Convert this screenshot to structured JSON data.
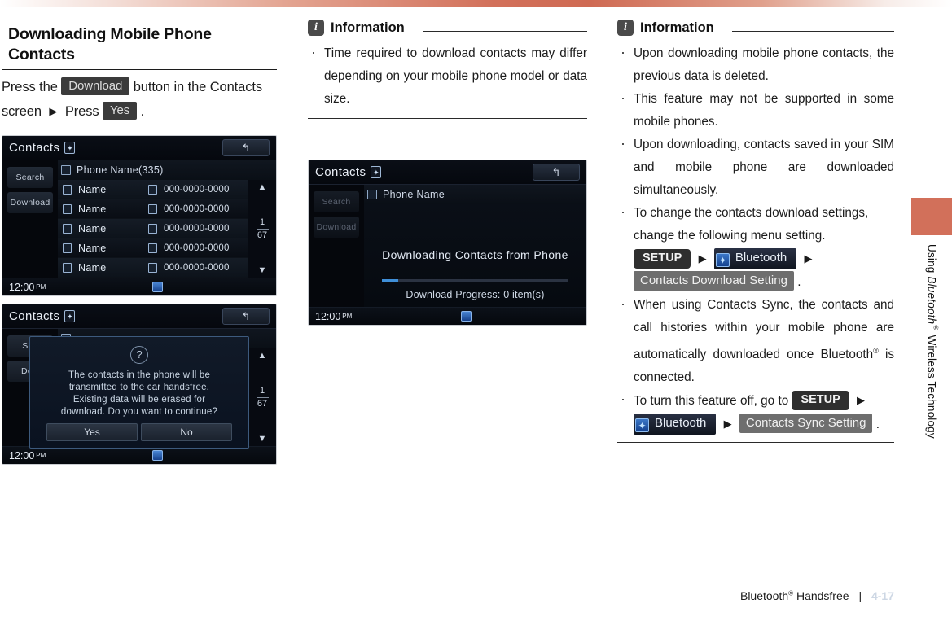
{
  "page": {
    "accent_color": "#d2705a",
    "side_tab_label_prefix": "Using ",
    "side_tab_label_italic": "Bluetooth",
    "side_tab_label_suffix": " Wireless Technology",
    "footer_text": "Bluetooth",
    "footer_text_suffix": " Handsfree",
    "footer_separator": "|",
    "footer_page": "4-17"
  },
  "left": {
    "title": "Downloading Mobile Phone Contacts",
    "instruction_part1": "Press the",
    "instruction_key_download": "Download",
    "instruction_part2": "button in the Contacts screen",
    "instruction_part3": "Press",
    "instruction_key_yes": "Yes",
    "instruction_period": "."
  },
  "screenshot_contacts": {
    "header_title": "Contacts",
    "back_icon": "↰",
    "rail": [
      {
        "label": "Search",
        "dim": false
      },
      {
        "label": "Download",
        "dim": false
      }
    ],
    "list_header": "Phone Name(335)",
    "rows": [
      {
        "name": "Name",
        "phone": "000-0000-0000"
      },
      {
        "name": "Name",
        "phone": "000-0000-0000"
      },
      {
        "name": "Name",
        "phone": "000-0000-0000"
      },
      {
        "name": "Name",
        "phone": "000-0000-0000"
      },
      {
        "name": "Name",
        "phone": "000-0000-0000"
      }
    ],
    "scroll_up": "▲",
    "scroll_down": "▼",
    "page_current": "1",
    "page_total": "67",
    "time": "12:00",
    "meridiem": "PM"
  },
  "screenshot_dialog": {
    "header_title": "Contacts",
    "back_icon": "↰",
    "rail": [
      {
        "label": "Sea",
        "dim": false
      },
      {
        "label": "Dow",
        "dim": false
      }
    ],
    "question_icon": "?",
    "message_line1": "The contacts in the phone will be",
    "message_line2": "transmitted to the car handsfree.",
    "message_line3": "Existing data will be erased for",
    "message_line4": "download. Do you want to continue?",
    "button_yes": "Yes",
    "button_no": "No",
    "scroll_up": "▲",
    "scroll_down": "▼",
    "page_current": "1",
    "page_total": "67",
    "time": "12:00",
    "meridiem": "PM"
  },
  "screenshot_progress": {
    "header_title": "Contacts",
    "back_icon": "↰",
    "rail": [
      {
        "label": "Search",
        "dim": true
      },
      {
        "label": "Download",
        "dim": true
      }
    ],
    "list_header": "Phone Name",
    "downloading_text": "Downloading Contacts from Phone",
    "progress_text": "Download  Progress: 0 item(s)",
    "progress_percent": 9,
    "time": "12:00",
    "meridiem": "PM"
  },
  "info_middle": {
    "title": "Information",
    "icon": "i",
    "bullets": [
      "Time required to download contacts may differ depending on your mobile phone model or data size."
    ]
  },
  "info_right": {
    "title": "Information",
    "icon": "i",
    "bullet1": "Upon downloading mobile phone contacts, the previous data is deleted.",
    "bullet2": "This feature may not be supported in some mobile phones.",
    "bullet3": "Upon downloading, contacts saved in your SIM and mobile phone are downloaded simultaneously.",
    "bullet4": "To change the contacts download settings, change the following menu setting.",
    "bullet4_key_setup": "SETUP",
    "bullet4_key_bluetooth": "Bluetooth",
    "bullet4_key_contacts_download": "Contacts Download Setting",
    "bullet4_period": ".",
    "bullet5_part1": "When using Contacts Sync, the contacts and call histories within your mobile phone are automatically downloaded once Bluetooth",
    "bullet5_part2": " is connected.",
    "bullet6_part1": "To turn this feature off, go to",
    "bullet6_key_setup": "SETUP",
    "bullet6_key_bluetooth": "Bluetooth",
    "bullet6_key_contacts_sync": "Contacts Sync Setting",
    "bullet6_period": ".",
    "arrow": "▶",
    "registered_mark": "®"
  }
}
